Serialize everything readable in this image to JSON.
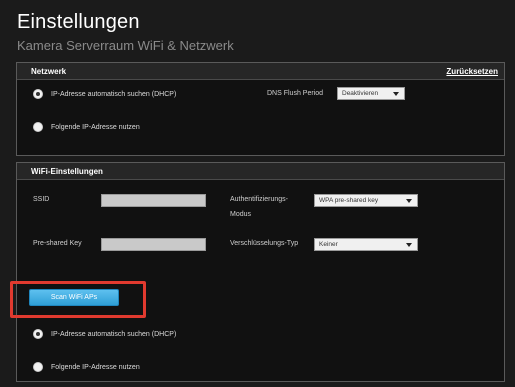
{
  "page": {
    "title": "Einstellungen",
    "subtitle": "Kamera Serverraum WiFi & Netzwerk"
  },
  "network": {
    "title": "Netzwerk",
    "reset_label": "Zurücksetzen",
    "dhcp_label": "IP-Adresse automatisch suchen (DHCP)",
    "static_label": "Folgende IP-Adresse nutzen",
    "selected": "dhcp",
    "dns_label": "DNS Flush Period",
    "dns_value": "Deaktivieren"
  },
  "wifi": {
    "title": "WiFi-Einstellungen",
    "ssid_label": "SSID",
    "ssid_value": "",
    "psk_label": "Pre-shared Key",
    "psk_value": "",
    "auth_label_line1": "Authentifizierungs-",
    "auth_label_line2": "Modus",
    "auth_value": "WPA pre-shared key",
    "enc_label": "Verschlüsselungs-Typ",
    "enc_value": "Keiner",
    "scan_button": "Scan WiFi APs",
    "dhcp_label": "IP-Adresse automatisch suchen (DHCP)",
    "static_label": "Folgende IP-Adresse nutzen",
    "selected": "dhcp"
  },
  "colors": {
    "highlight": "#e13a2f",
    "button": "#3aaee6"
  }
}
